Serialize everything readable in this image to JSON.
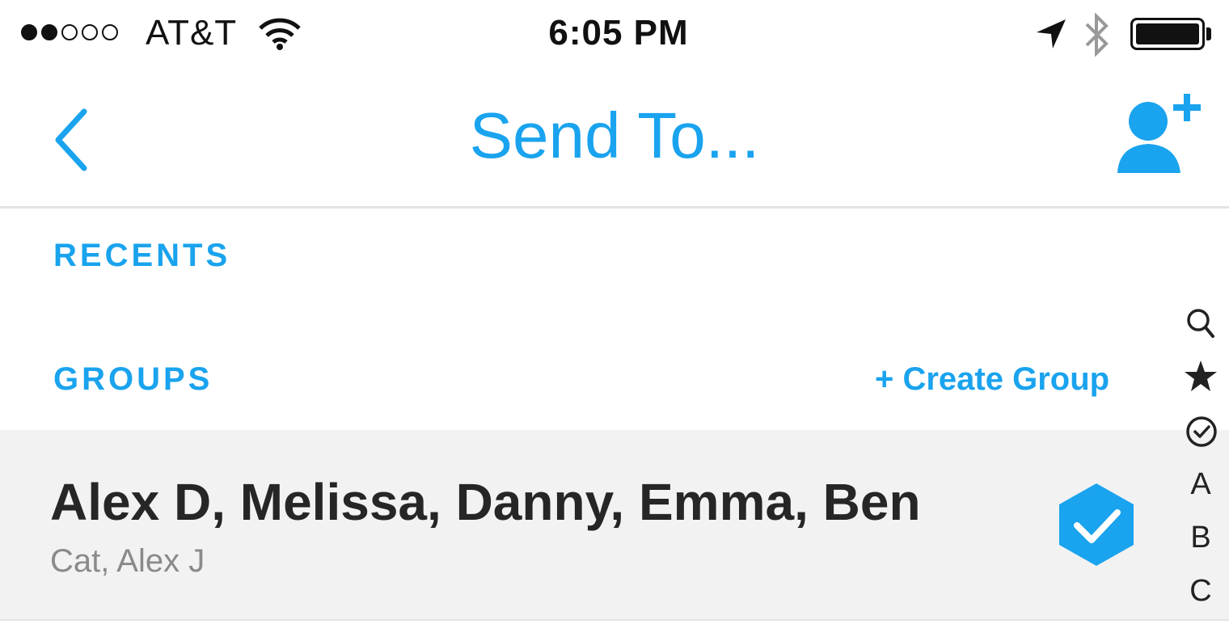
{
  "status_bar": {
    "carrier": "AT&T",
    "time": "6:05 PM",
    "signal_bars_filled": 2,
    "signal_bars_total": 5,
    "icons": [
      "wifi-icon",
      "location-arrow-icon",
      "bluetooth-icon",
      "battery-icon"
    ],
    "battery_level": 1.0
  },
  "nav": {
    "title": "Send To...",
    "back_icon": "chevron-left-icon",
    "add_friend_icon": "add-friend-icon"
  },
  "sections": {
    "recents": "RECENTS",
    "groups": "GROUPS",
    "create_group": "+ Create Group"
  },
  "group": {
    "names": "Alex D, Melissa, Danny, Emma, Ben",
    "more_names": "Cat, Alex J",
    "selected": true
  },
  "index_bar": {
    "icons": [
      "search-icon",
      "star-icon",
      "check-circle-icon"
    ],
    "letters": [
      "A",
      "B",
      "C"
    ]
  },
  "colors": {
    "accent": "#1aa3ee",
    "row_background": "#f2f2f2",
    "text_dark": "#262626",
    "text_muted": "#8a8a8a"
  }
}
